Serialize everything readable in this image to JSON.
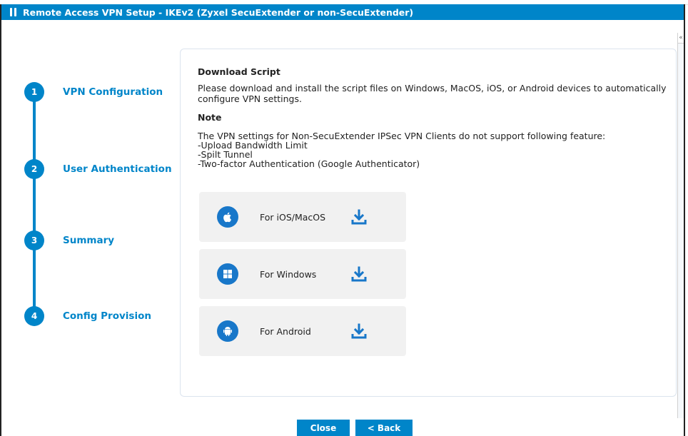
{
  "window": {
    "title": "Remote Access VPN Setup - IKEv2 (Zyxel SecuExtender or non-SecuExtender)"
  },
  "steps": [
    {
      "number": "1",
      "label": "VPN Configuration"
    },
    {
      "number": "2",
      "label": "User Authentication"
    },
    {
      "number": "3",
      "label": "Summary"
    },
    {
      "number": "4",
      "label": "Config Provision"
    }
  ],
  "panel": {
    "title": "Download Script",
    "description": "Please download and install the script files on Windows, MacOS, iOS, or Android devices to automatically configure VPN settings.",
    "note_heading": "Note",
    "note_intro": "The VPN settings for Non-SecuExtender IPSec VPN Clients do not support following feature:",
    "features": [
      "-Upload Bandwidth Limit",
      "-Spilt Tunnel",
      "-Two-factor Authentication (Google Authenticator)"
    ],
    "downloads": [
      {
        "label": "For iOS/MacOS",
        "icon": "apple-icon"
      },
      {
        "label": "For Windows",
        "icon": "windows-icon"
      },
      {
        "label": "For Android",
        "icon": "android-icon"
      }
    ]
  },
  "buttons": {
    "close": "Close",
    "back": "< Back"
  },
  "colors": {
    "accent": "#0085c9",
    "card_bg": "#f1f1f1",
    "os_icon_bg": "#1877c9"
  }
}
